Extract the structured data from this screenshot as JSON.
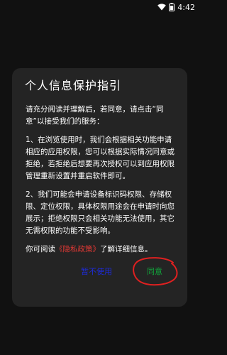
{
  "status_bar": {
    "time": "4:42",
    "icons": [
      "wifi-icon",
      "battery-icon"
    ]
  },
  "dialog": {
    "title": "个人信息保护指引",
    "intro": "请充分阅读并理解后，若同意，请点击“同意”以接受我们的服务：",
    "item1": "1、在浏览使用时，我们会根据相关功能申请相应的应用权限，您可以根据实际情况同意或拒绝，若拒绝后想要再次授权可以到应用权限管理重新设置并重启软件即可。",
    "item2": "2、我们可能会申请设备标识码权限、存储权限、定位权限，具体权限用途会在申请时向您展示；拒绝权限只会相关功能无法使用，其它无需权限的功能不受影响。",
    "privacy_prefix": "你可阅读",
    "privacy_link": "《隐私政策》",
    "privacy_suffix": "了解详细信息。",
    "disagree_label": "暂不使用",
    "agree_label": "同意"
  },
  "colors": {
    "background": "#111111",
    "dialog_bg": "#242424",
    "link": "#e53935",
    "disagree": "#1e2bd6",
    "agree": "#11a83c",
    "annotation_circle": "#e02020"
  }
}
